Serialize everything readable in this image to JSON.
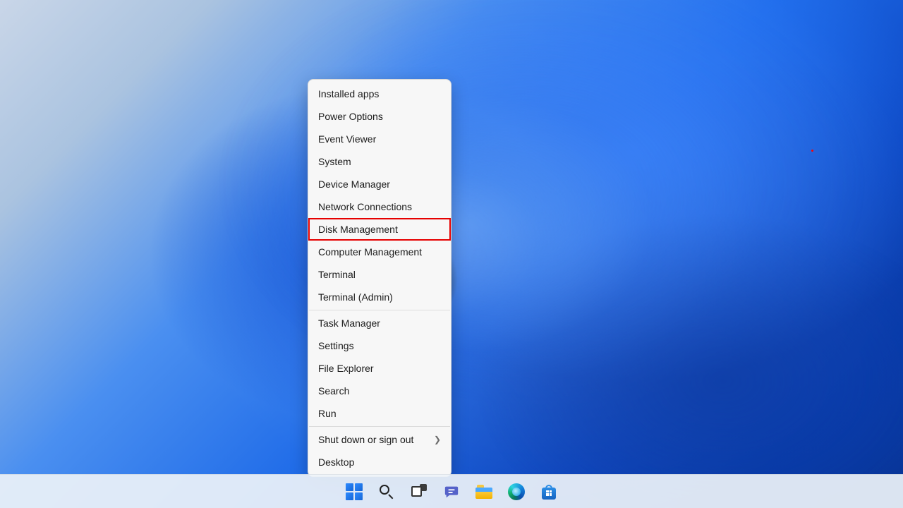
{
  "context_menu": {
    "items": [
      {
        "label": "Installed apps",
        "highlighted": false,
        "submenu": false
      },
      {
        "label": "Power Options",
        "highlighted": false,
        "submenu": false
      },
      {
        "label": "Event Viewer",
        "highlighted": false,
        "submenu": false
      },
      {
        "label": "System",
        "highlighted": false,
        "submenu": false
      },
      {
        "label": "Device Manager",
        "highlighted": false,
        "submenu": false
      },
      {
        "label": "Network Connections",
        "highlighted": false,
        "submenu": false
      },
      {
        "label": "Disk Management",
        "highlighted": true,
        "submenu": false
      },
      {
        "label": "Computer Management",
        "highlighted": false,
        "submenu": false
      },
      {
        "label": "Terminal",
        "highlighted": false,
        "submenu": false
      },
      {
        "label": "Terminal (Admin)",
        "highlighted": false,
        "submenu": false
      },
      {
        "separator": true
      },
      {
        "label": "Task Manager",
        "highlighted": false,
        "submenu": false
      },
      {
        "label": "Settings",
        "highlighted": false,
        "submenu": false
      },
      {
        "label": "File Explorer",
        "highlighted": false,
        "submenu": false
      },
      {
        "label": "Search",
        "highlighted": false,
        "submenu": false
      },
      {
        "label": "Run",
        "highlighted": false,
        "submenu": false
      },
      {
        "separator": true
      },
      {
        "label": "Shut down or sign out",
        "highlighted": false,
        "submenu": true
      },
      {
        "label": "Desktop",
        "highlighted": false,
        "submenu": false
      }
    ]
  },
  "taskbar": {
    "items": [
      {
        "name": "start",
        "icon": "start-icon"
      },
      {
        "name": "search",
        "icon": "search-icon"
      },
      {
        "name": "task-view",
        "icon": "taskview-icon"
      },
      {
        "name": "chat",
        "icon": "chat-icon"
      },
      {
        "name": "file-explorer",
        "icon": "explorer-icon"
      },
      {
        "name": "edge",
        "icon": "edge-icon"
      },
      {
        "name": "store",
        "icon": "store-icon"
      }
    ]
  }
}
